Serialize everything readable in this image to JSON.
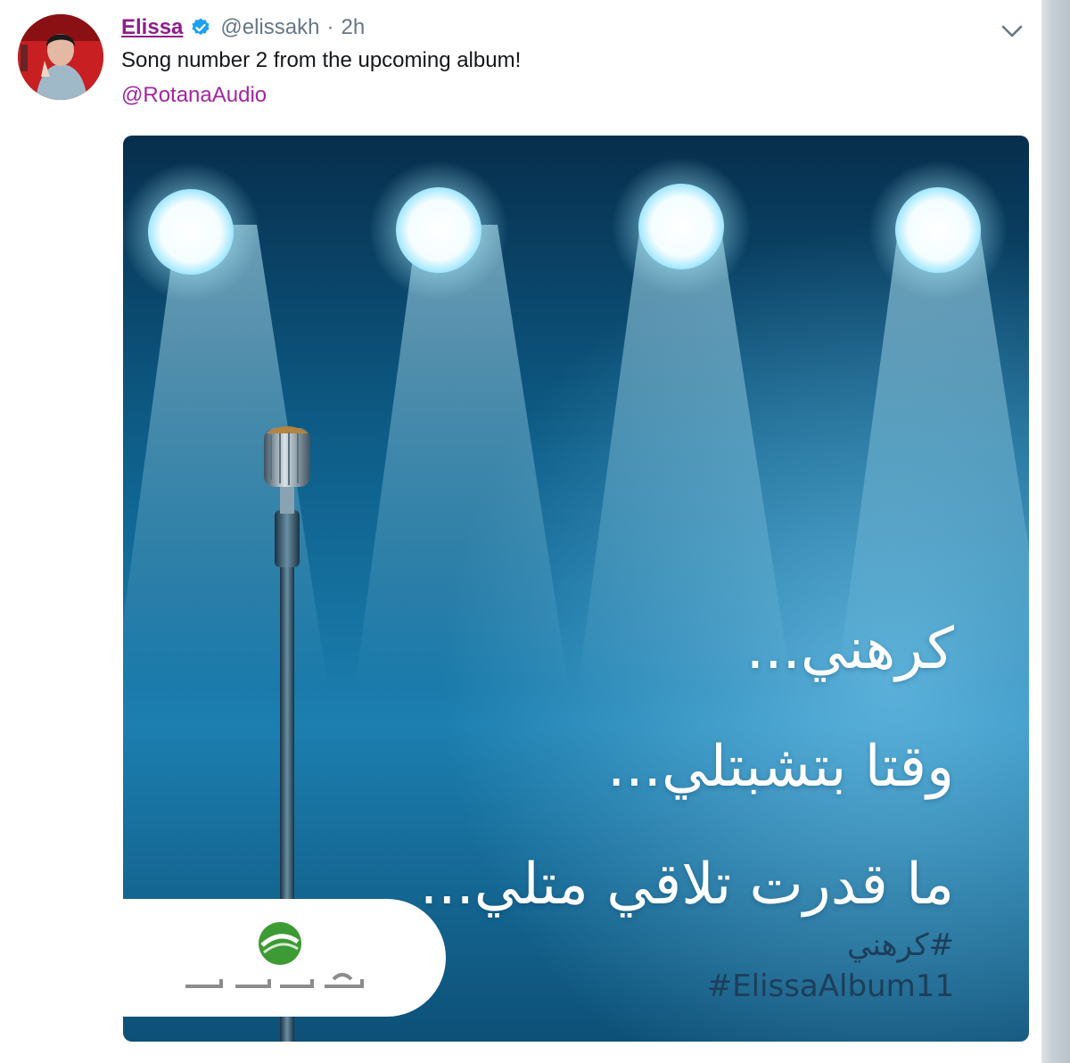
{
  "tweet": {
    "display_name": "Elissa",
    "handle": "@elissakh",
    "separator": "·",
    "time": "2h",
    "text": "Song number 2 from the upcoming album!",
    "mention": "@RotanaAudio"
  },
  "media": {
    "lyrics": [
      "كرهني...",
      "وقتا بتشبتلي...",
      "ما قدرت تلاقي متلي..."
    ],
    "hashtags": [
      "#كرهني",
      "#ElissaAlbum11"
    ],
    "logo": "rotana-logo"
  },
  "colors": {
    "name": "#8e1d8f",
    "mention": "#a2269f",
    "verified": "#1da1f2",
    "stage_blue": "#0f6a96"
  },
  "icons": [
    "verified-badge-icon",
    "chevron-down-icon",
    "rotana-logo"
  ]
}
